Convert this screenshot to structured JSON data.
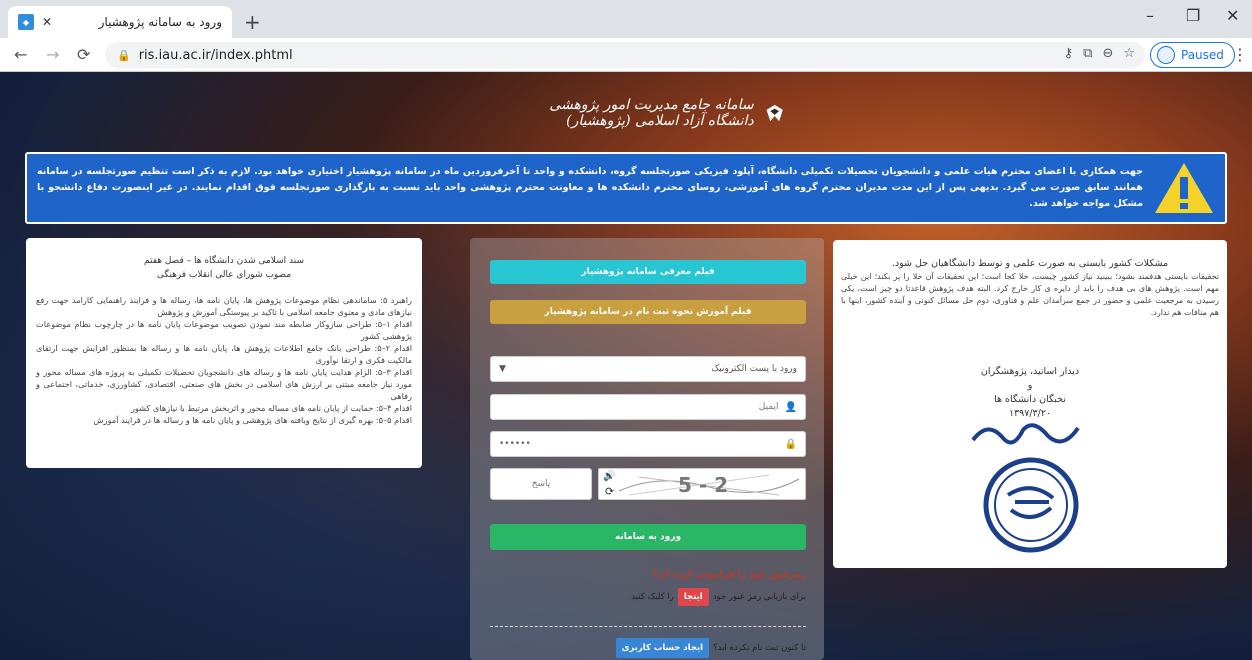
{
  "browser": {
    "tab_title": "ورود به سامانه پژوهشیار",
    "url": "ris.iau.ac.ir/index.phtml",
    "profile_status": "Paused"
  },
  "header": {
    "logo_text": "سامانه جامع مدیریت امور پژوهشی دانشگاه آزاد اسلامی (پژوهشیار)"
  },
  "alert": {
    "text": "جهت همکاری با اعضای محترم هیات علمی و دانشجویان تحصیلات تکمیلی دانشگاه، آپلود فیزیکی صورتجلسه گروه، دانشکده و واحد تا آخرفروردین ماه در سامانه پژوهشیار اختیاری خواهد بود. لازم به ذکر است تنظیم صورتجلسه در سامانه همانند سابق صورت می گیرد. بدیهی پس از این مدت مدیران محترم گروه های آموزشی، روسای محترم دانشکده ها و معاونت محترم پژوهشی واحد باید نسبت به بارگذاری صورتجلسه فوق اقدام نمایند. در غیر اینصورت دفاع دانشجو با مشکل مواجه خواهد شد."
  },
  "left_card": {
    "title": "سند اسلامی شدن دانشگاه ها – فصل هفتم",
    "subtitle": "مصوب شورای عالی انقلاب فرهنگی",
    "paragraphs": [
      "راهبرد ۵: ساماندهی نظام موضوعات پژوهش ها، پایان نامه ها، رساله ها و فرایند راهنمایی کارامد جهت رفع نیازهای مادی و معنوی جامعه اسلامی با تاکید بر پیوستگی آموزش و پژوهش",
      "اقدام ۱–۵: طراحی سازوکار ضابطه مند نمودن تصویب موضوعات پایان نامه ها در چارچوب نظام موضوعات پژوهشی کشور",
      "اقدام ۲–۵: طراحی بانک جامع اطلاعات پژوهش ها، پایان نامه ها و رساله ها بمنظور افزایش جهت ارتقای مالکیت فکری و ارتقا نوآوری",
      "اقدام ۳–۵: الزام هدایت پایان نامه ها و رساله های دانشجویان تحصیلات تکمیلی به پروژه های مساله محور و مورد نیاز جامعه مبتنی بر ارزش های اسلامی در بخش های صنعتی، اقتصادی، کشاورزی، خدماتی، اجتماعی و رفاهی",
      "اقدام ۴–۵: حمایت از پایان نامه های مساله محور و اثربخش مرتبط با نیازهای کشور",
      "اقدام ۵–۵: بهره گیری از نتایج ویافته های پژوهشی و پایان نامه ها و رساله ها در فرایند آموزش"
    ]
  },
  "right_card": {
    "heading": "مشکلات کشور بایستی به صورت علمی و توسط دانشگاهیان حل شود.",
    "body": "تحقیقات بایستی هدفمند بشود؛ ببینید نیاز کشور چیست، خلا کجا است؛ این تحقیقات آن خلا را پر بکند؛ این خیلی مهم است. پژوهش های بی هدف را باید از دایره ی کار خارج کرد. البته هدف پژوهش قاعدتا دو چیز است، یکی رسیدن به مرجعیت علمی و حضور در جمع سرآمدان علم و فناوری، دوم حل مسائل کنونی و آینده کشور، اینها با هم منافات هم ندارد.",
    "meeting_line1": "دیدار اساتید، پژوهشگران",
    "meeting_line2": "و",
    "meeting_line3": "نخبگان دانشگاه ها",
    "meeting_date": "۱۳۹۷/۳/۲۰"
  },
  "login": {
    "video1_label": "فیلم معرفی سامانه پژوهشیار",
    "video2_label": "فیلم آموزش نحوه ثبت نام در سامانه پژوهشیار",
    "login_method": "ورود با پست الکترونیک",
    "email_placeholder": "ایمیل",
    "password_value": "••••••",
    "captcha_text": "5 - 2",
    "answer_placeholder": "پاسخ",
    "login_button": "ورود به سامانه",
    "forgot_question": "رمزعبور خود را فراموش کرده اید؟",
    "recover_prefix": "برای بازیابی رمز عبور خود",
    "here_button": "اینجا",
    "recover_suffix": "را کلیک کنید",
    "signup_question": "تا کنون ثبت نام نکرده اید؟",
    "signup_button": "ایجاد حساب کاربری"
  },
  "colors": {
    "alert_bg": "#1f64c8",
    "video1": "#28c6d3",
    "video2": "#c9a040",
    "login": "#2ab567",
    "danger": "#e0474c",
    "primary": "#3a86d6"
  }
}
